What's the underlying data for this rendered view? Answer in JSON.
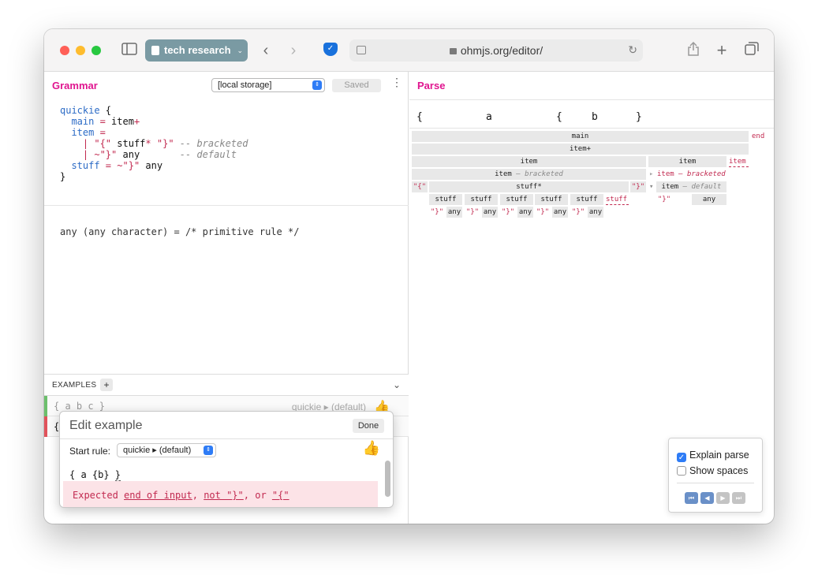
{
  "browser": {
    "tab_group": "tech research",
    "url": "ohmjs.org/editor/"
  },
  "grammar_pane": {
    "title": "Grammar",
    "storage_select": "[local storage]",
    "saved_label": "Saved",
    "code_lines": {
      "l1_name": "quickie",
      "l1_brace": " {",
      "l2_rule": "main",
      "l2_eq": " = ",
      "l2_body": "item",
      "l2_op": "+",
      "l3_rule": "item",
      "l3_eq": " =",
      "l4_bar": "| ",
      "l4_str1": "\"{\"",
      "l4_ref": " stuff",
      "l4_op": "*",
      "l4_str2": " \"}\"",
      "l4_comment": " -- bracketed",
      "l5_bar": "| ",
      "l5_str": "~\"}\"",
      "l5_ref": " any",
      "l5_comment": "       -- default",
      "l6_rule": "stuff",
      "l6_eq": " = ",
      "l6_str": "~\"}\"",
      "l6_ref": " any",
      "l7": "}"
    },
    "primitive_desc": "any (any character) = /* primitive rule */"
  },
  "examples": {
    "label": "EXAMPLES",
    "add_label": "+",
    "items": [
      {
        "text": "{ a b c }",
        "rule": "quickie ▸ (default)"
      },
      {
        "text": "{"
      }
    ]
  },
  "edit_popup": {
    "title": "Edit example",
    "done_label": "Done",
    "start_rule_label": "Start rule:",
    "start_rule_value": "quickie ▸ (default)",
    "input_prefix": "{ a {b} ",
    "input_err_char": "}",
    "error": {
      "prefix": "Expected ",
      "opt1": "end of input",
      "sep1": ", ",
      "opt2": "not \"}\"",
      "sep2": ", or ",
      "opt3": "\"{\""
    }
  },
  "parse_pane": {
    "title": "Parse",
    "input_chars": [
      "{",
      "a",
      "{",
      "b",
      "}"
    ],
    "tree": {
      "main": "main",
      "end": "end",
      "item_plus": "item+",
      "item1": "item",
      "item2": "item",
      "item_fail": "item",
      "item_bracketed": "item",
      "bracketed_case": "— bracketed",
      "item_bracketed2": "item",
      "bracketed_case2": "— bracketed",
      "item_default": "item",
      "default_case": "— default",
      "lit_open": "\"{\"",
      "stuff_star": "stuff*",
      "lit_close": "\"}\"",
      "stuff": "stuff",
      "stuff_fail": "stuff",
      "not_close": "\"}\"",
      "any": "any"
    },
    "explain_label": "Explain parse",
    "explain_checked": true,
    "spaces_label": "Show spaces",
    "spaces_checked": false,
    "controls": [
      "rewind-icon",
      "step-back-icon",
      "play-icon",
      "fast-forward-icon"
    ]
  },
  "colors": {
    "accent_pink": "#e0158f",
    "keyword_blue": "#2c6bc6",
    "string_red": "#c22a50",
    "tab_group": "#7a9aa3",
    "pass_green": "#6cbf6c",
    "fail_red": "#e0525b"
  }
}
